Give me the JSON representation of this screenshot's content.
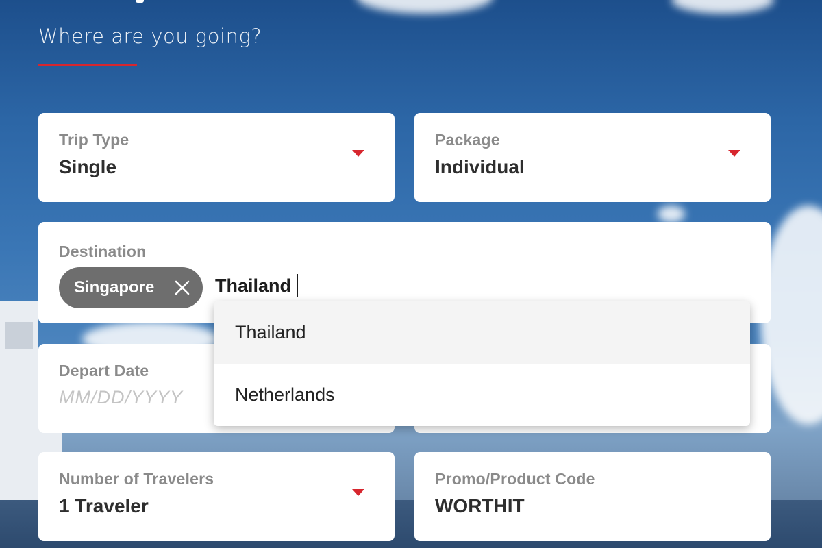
{
  "header": {
    "subtitle": "Where are you going?",
    "accent_color": "#d7262e"
  },
  "form": {
    "trip_type": {
      "label": "Trip Type",
      "value": "Single"
    },
    "package": {
      "label": "Package",
      "value": "Individual"
    },
    "destination": {
      "label": "Destination",
      "selected_chips": [
        "Singapore"
      ],
      "typed_value": "Thailand",
      "suggestions": [
        "Thailand",
        "Netherlands"
      ]
    },
    "depart_date": {
      "label": "Depart Date",
      "placeholder": "MM/DD/YYYY"
    },
    "travelers": {
      "label": "Number of Travelers",
      "value": "1 Traveler"
    },
    "promo_code": {
      "label": "Promo/Product Code",
      "value": "WORTHIT"
    }
  },
  "icons": {
    "dropdown_caret": "chevron-down-icon",
    "chip_remove": "close-icon"
  }
}
